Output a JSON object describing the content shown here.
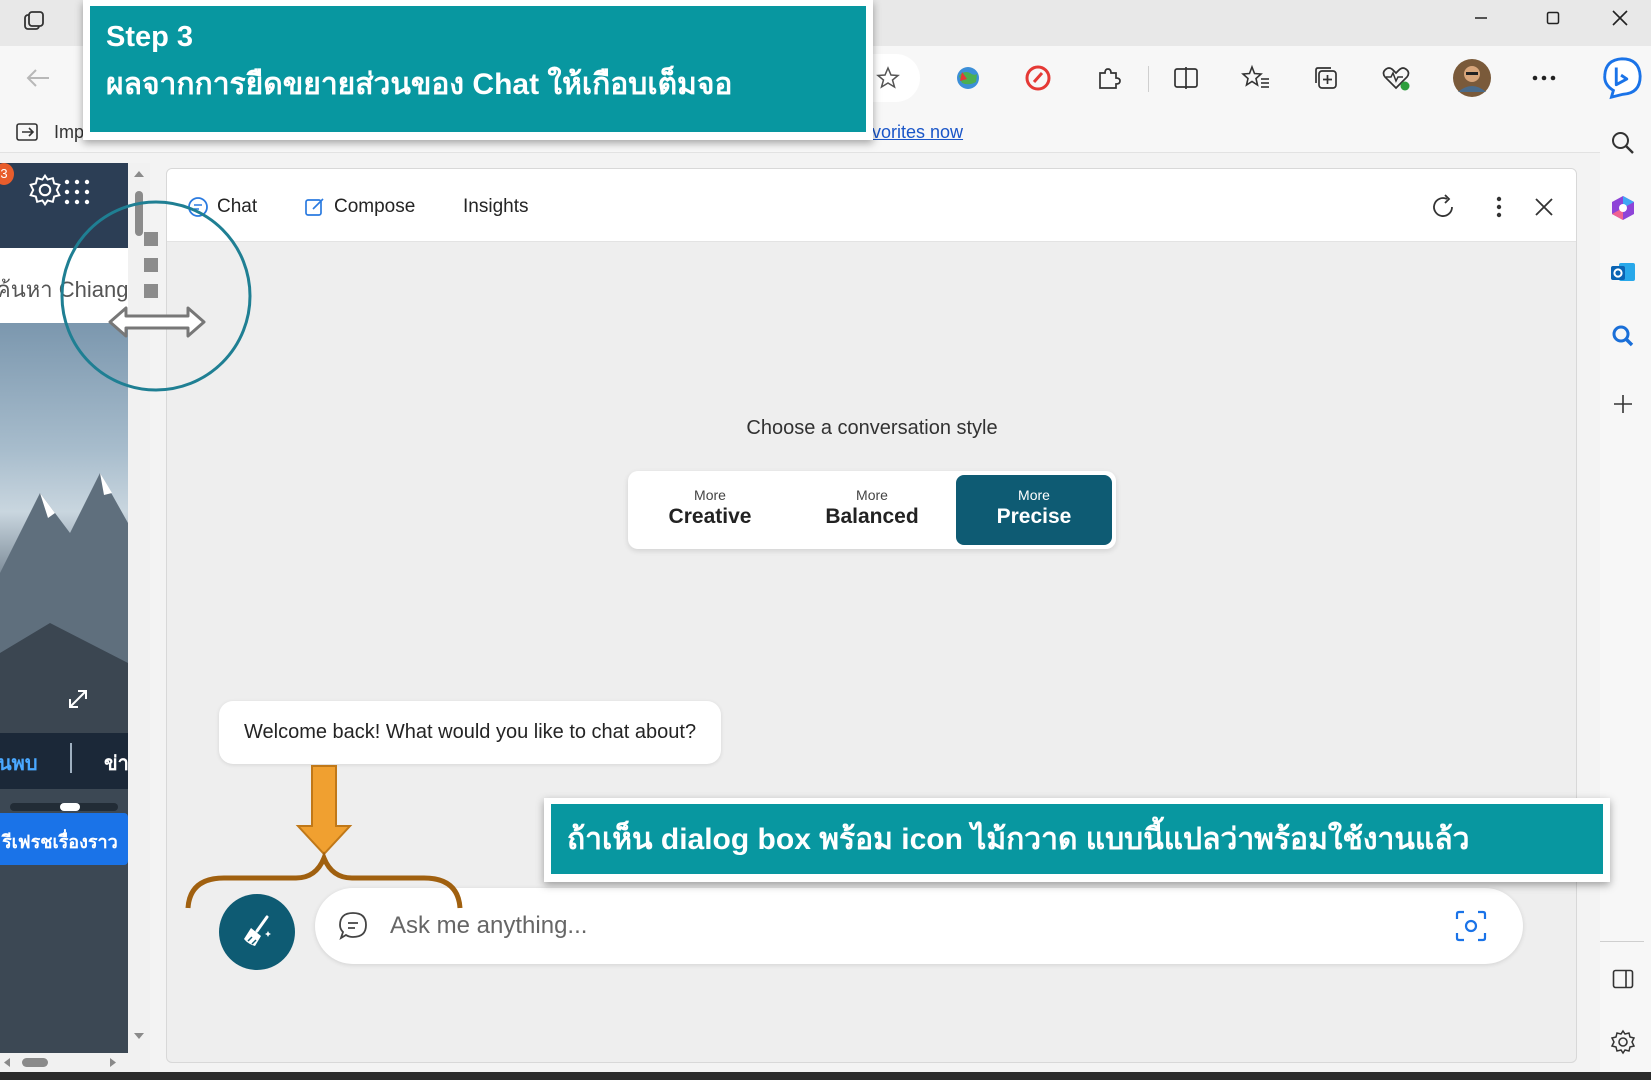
{
  "browser": {
    "favorites_bar": {
      "import_label": "Imp",
      "link_fragment": "vorites now"
    },
    "toolbar_icons": [
      "star-icon",
      "extension-globe-icon",
      "blocker-icon",
      "puzzle-icon",
      "split-screen-icon",
      "favorites-icon",
      "collections-icon",
      "health-icon",
      "profile-avatar",
      "more-icon",
      "bing-icon"
    ],
    "sidebar_icons": [
      "search-icon",
      "copilot-icon",
      "outlook-icon",
      "zoom-search-icon",
      "add-icon",
      "sidebar-layout-icon",
      "settings-icon"
    ],
    "window_controls": [
      "minimize-icon",
      "maximize-icon",
      "close-icon"
    ]
  },
  "left_page": {
    "notification_count": "3",
    "search_text": "ค้นหา Chiang",
    "nav_left": "นพบ",
    "nav_right": "ข่า",
    "refresh_label": "รีเฟรชเรื่องราว"
  },
  "chat": {
    "tabs": [
      {
        "label": "Chat",
        "icon": "chat-icon",
        "active": true
      },
      {
        "label": "Compose",
        "icon": "compose-icon",
        "active": false
      },
      {
        "label": "Insights",
        "icon": "",
        "active": false
      }
    ],
    "header_actions": [
      "refresh-icon",
      "more-vertical-icon",
      "close-icon"
    ],
    "style_prompt": "Choose a conversation style",
    "styles": [
      {
        "small": "More",
        "big": "Creative",
        "selected": false
      },
      {
        "small": "More",
        "big": "Balanced",
        "selected": false
      },
      {
        "small": "More",
        "big": "Precise",
        "selected": true
      }
    ],
    "welcome_message": "Welcome back! What would you like to chat about?",
    "input_placeholder": "Ask me anything...",
    "new_topic_icon": "broom-icon",
    "accent_color": "#0e5b73"
  },
  "annotations": {
    "step_title": "Step 3",
    "step_desc": "ผลจากการยืดขยายส่วนของ Chat ให้เกือบเต็มจอ",
    "bottom_note": "ถ้าเห็น dialog box พร้อม icon ไม้กวาด แบบนี้แปลว่าพร้อมใช้งานแล้ว",
    "callout_color": "#0897a0",
    "arrow_color": "#f0a030",
    "brace_color": "#a0600f",
    "circle_color": "#1f7f93"
  }
}
